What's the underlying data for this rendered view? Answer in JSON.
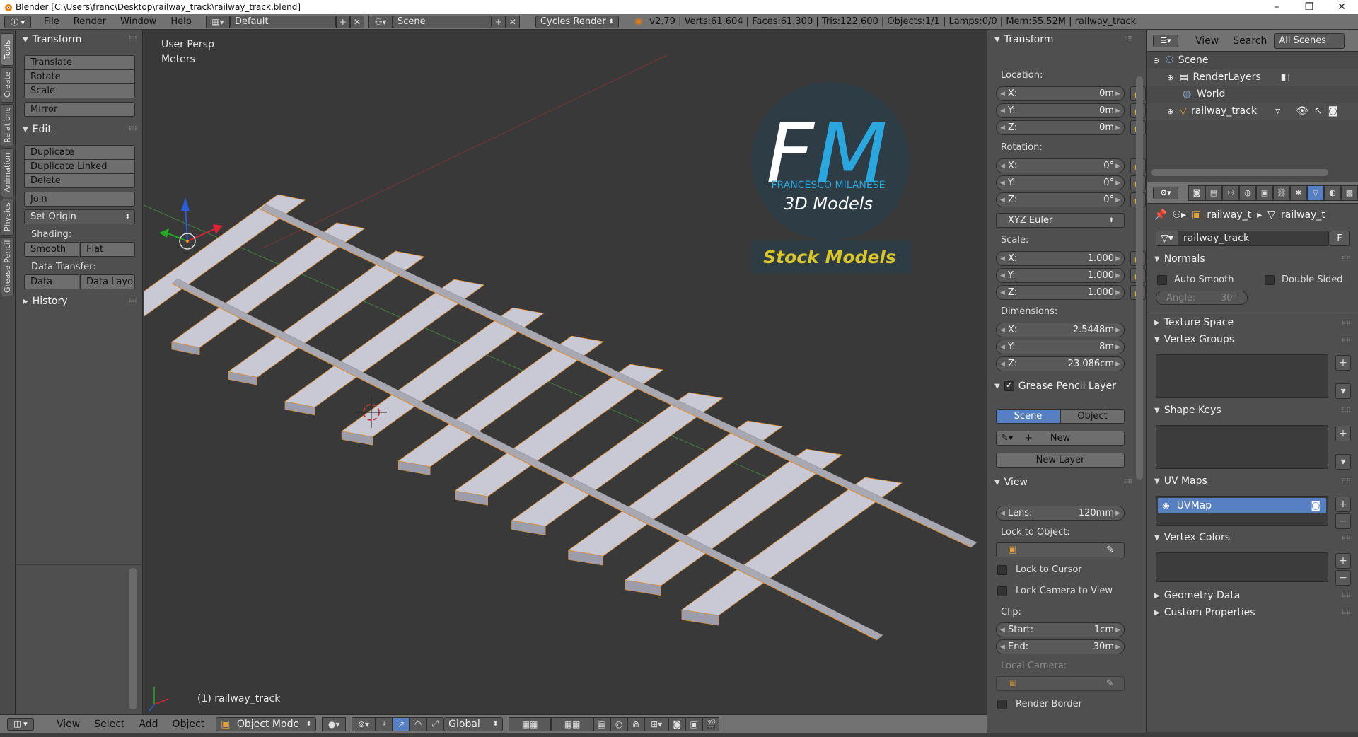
{
  "window": {
    "title": "Blender [C:\\Users\\franc\\Desktop\\railway_track\\railway_track.blend]",
    "minimize": "–",
    "maximize": "❐",
    "close": "✕"
  },
  "topbar": {
    "menus": [
      "File",
      "Render",
      "Window",
      "Help"
    ],
    "screen_layout": "Default",
    "scene": "Scene",
    "engine": "Cycles Render",
    "stats": "v2.79 | Verts:61,604 | Faces:61,300 | Tris:122,600 | Objects:1/1 | Lamps:0/0 | Mem:55.52M | railway_track"
  },
  "left_tabs": [
    "Tools",
    "Create",
    "Relations",
    "Animation",
    "Physics",
    "Grease Pencil"
  ],
  "toolshelf": {
    "transform_header": "Transform",
    "translate": "Translate",
    "rotate": "Rotate",
    "scale": "Scale",
    "mirror": "Mirror",
    "edit_header": "Edit",
    "duplicate": "Duplicate",
    "duplicate_linked": "Duplicate Linked",
    "delete": "Delete",
    "join": "Join",
    "set_origin": "Set Origin",
    "shading_label": "Shading:",
    "smooth": "Smooth",
    "flat": "Flat",
    "data_transfer_label": "Data Transfer:",
    "data": "Data",
    "data_layout": "Data Layo",
    "history_header": "History"
  },
  "viewport": {
    "view_name": "User Persp",
    "units": "Meters",
    "object_label": "(1) railway_track",
    "logo_initials": "FM",
    "logo_name": "FRANCESCO MILANESE",
    "logo_subtitle": "3D Models",
    "logo_banner": "Stock Models"
  },
  "bottombar": {
    "menus": [
      "View",
      "Select",
      "Add",
      "Object"
    ],
    "mode": "Object Mode",
    "orientation": "Global"
  },
  "npanel": {
    "transform_header": "Transform",
    "location_label": "Location:",
    "location": {
      "x": "0m",
      "y": "0m",
      "z": "0m"
    },
    "rotation_label": "Rotation:",
    "rotation": {
      "x": "0°",
      "y": "0°",
      "z": "0°"
    },
    "rotation_mode": "XYZ Euler",
    "scale_label": "Scale:",
    "scale": {
      "x": "1.000",
      "y": "1.000",
      "z": "1.000"
    },
    "dimensions_label": "Dimensions:",
    "dimensions": {
      "x": "2.5448m",
      "y": "8m",
      "z": "23.086cm"
    },
    "axis_x": "X:",
    "axis_y": "Y:",
    "axis_z": "Z:",
    "grease_header": "Grease Pencil Layer",
    "scene_btn": "Scene",
    "object_btn": "Object",
    "new_btn": "New",
    "new_layer_btn": "New Layer",
    "view_header": "View",
    "lens_label": "Lens:",
    "lens_value": "120mm",
    "lock_to_object_label": "Lock to Object:",
    "lock_to_cursor": "Lock to Cursor",
    "lock_camera_to_view": "Lock Camera to View",
    "clip_label": "Clip:",
    "clip_start_label": "Start:",
    "clip_start": "1cm",
    "clip_end_label": "End:",
    "clip_end": "30m",
    "local_camera_label": "Local Camera:",
    "render_border": "Render Border"
  },
  "outliner": {
    "view": "View",
    "search": "Search",
    "filter": "All Scenes",
    "items": [
      "Scene",
      "RenderLayers",
      "World",
      "railway_track"
    ]
  },
  "properties": {
    "breadcrumb_object": "railway_t",
    "breadcrumb_mesh": "railway_t",
    "mesh_name": "railway_track",
    "fake_user": "F",
    "normals_header": "Normals",
    "auto_smooth": "Auto Smooth",
    "double_sided": "Double Sided",
    "angle_label": "Angle:",
    "angle_value": "30°",
    "texture_space_header": "Texture Space",
    "vertex_groups_header": "Vertex Groups",
    "shape_keys_header": "Shape Keys",
    "uv_maps_header": "UV Maps",
    "uv_map_name": "UVMap",
    "vertex_colors_header": "Vertex Colors",
    "geometry_data_header": "Geometry Data",
    "custom_properties_header": "Custom Properties"
  },
  "colors": {
    "accent_blue": "#5680c2",
    "logo_cyan": "#2aa7de",
    "logo_yellow": "#d8c52a",
    "mesh_fill": "#c9c9d6"
  }
}
